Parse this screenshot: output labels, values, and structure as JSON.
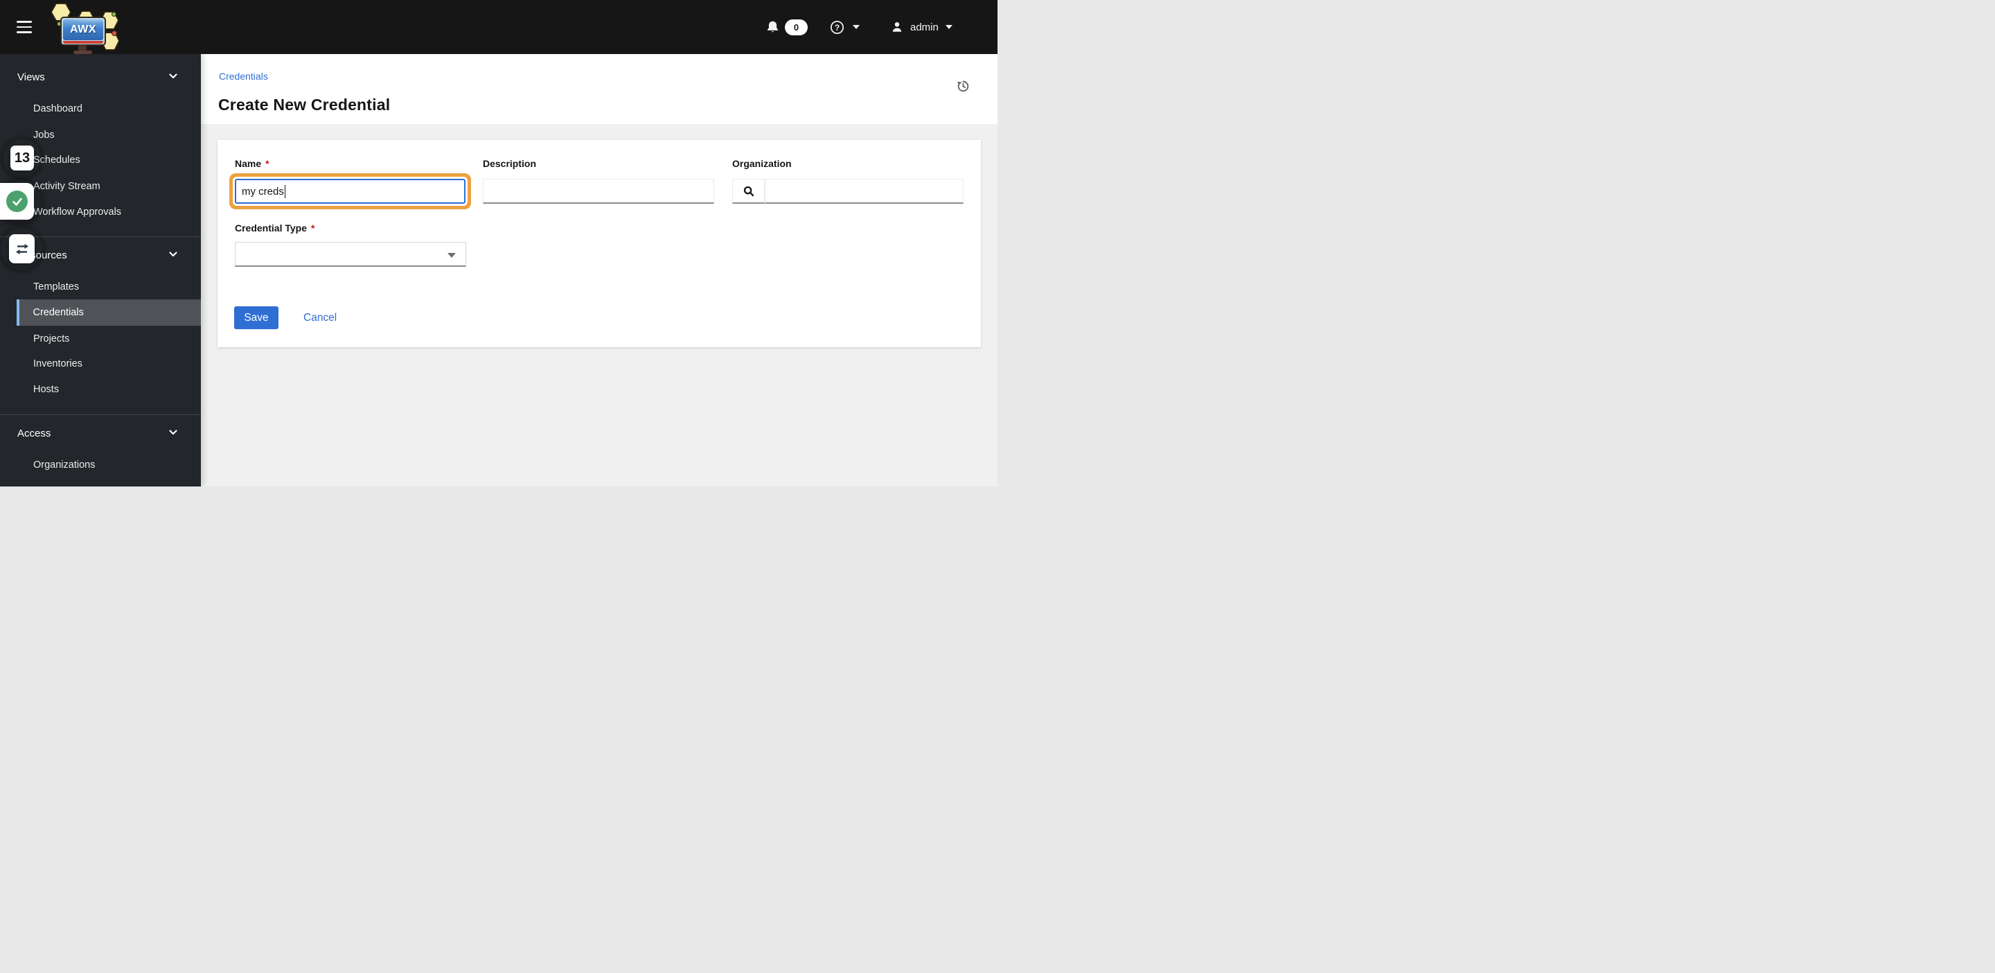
{
  "header": {
    "app_name": "AWX",
    "notification_count": "0",
    "username": "admin"
  },
  "sidebar": {
    "groups": [
      {
        "label": "Views",
        "items": [
          {
            "label": "Dashboard"
          },
          {
            "label": "Jobs"
          },
          {
            "label": "Schedules"
          },
          {
            "label": "Activity Stream"
          },
          {
            "label": "Workflow Approvals"
          }
        ]
      },
      {
        "label": "Resources",
        "items": [
          {
            "label": "Templates"
          },
          {
            "label": "Credentials",
            "selected": true
          },
          {
            "label": "Projects"
          },
          {
            "label": "Inventories"
          },
          {
            "label": "Hosts"
          }
        ]
      },
      {
        "label": "Access",
        "items": [
          {
            "label": "Organizations"
          }
        ]
      }
    ]
  },
  "annotations": {
    "step_count": "13",
    "status_icon": "green-check",
    "action_icon": "swap-arrows"
  },
  "breadcrumb": {
    "items": [
      {
        "label": "Credentials"
      }
    ]
  },
  "page": {
    "title": "Create New Credential"
  },
  "form": {
    "required_marker": "*",
    "name": {
      "label": "Name",
      "value": "my creds",
      "required": true
    },
    "description": {
      "label": "Description",
      "value": ""
    },
    "organization": {
      "label": "Organization",
      "value": ""
    },
    "credential_type": {
      "label": "Credential Type",
      "value": "",
      "required": true
    },
    "actions": {
      "save": "Save",
      "cancel": "Cancel"
    }
  },
  "icons": {
    "bell": "notifications bell",
    "question_circle": "help question mark in circle",
    "user": "person silhouette",
    "search": "magnifier",
    "history": "clock with counterclockwise arrow",
    "check": "white checkmark in green circle",
    "swap": "two opposing horizontal arrows"
  },
  "colors": {
    "primary_blue": "#2f6ed3",
    "focus_border": "#2b6fd4",
    "highlight_orange": "#eca23f",
    "success_green": "#4ca16c",
    "selected_bar": "#84baf0",
    "required_red": "#c9190b",
    "masthead_bg": "#161617",
    "sidebar_bg": "#23262a"
  }
}
